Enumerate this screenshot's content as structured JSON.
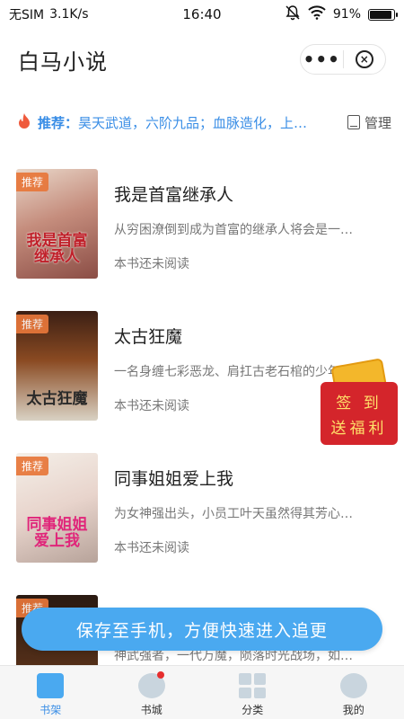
{
  "status_bar": {
    "carrier": "无SIM",
    "speed": "3.1K/s",
    "time": "16:40",
    "battery": "91%",
    "battery_level": 0.91,
    "icons": [
      "mute-bell-icon",
      "wifi-icon",
      "battery-icon"
    ]
  },
  "header": {
    "title": "白马小说",
    "more_icon": "more-dots-icon",
    "close_icon": "close-circle-icon"
  },
  "recommend": {
    "label": "推荐：",
    "text": "昊天武道，六阶九品；血脉造化，上…",
    "manage_label": "管理",
    "icon": "fire-icon"
  },
  "books": [
    {
      "tag": "推荐",
      "cover_title": "我是首富继承人",
      "name": "我是首富继承人",
      "desc": "从穷困潦倒到成为首富的继承人将会是一…",
      "status": "本书还未阅读"
    },
    {
      "tag": "推荐",
      "cover_title": "太古狂魔",
      "name": "太古狂魔",
      "desc": "一名身缠七彩恶龙、肩扛古老石棺的少年…",
      "status": "本书还未阅读"
    },
    {
      "tag": "推荐",
      "cover_title": "同事姐姐爱上我",
      "name": "同事姐姐爱上我",
      "desc": "为女神强出头，小员工叶天虽然得其芳心…",
      "status": "本书还未阅读"
    },
    {
      "tag": "推荐",
      "cover_title": "",
      "name": "",
      "desc": "神武强者，一代万魔，陨落时光战场，如…",
      "status": ""
    }
  ],
  "float_gift": {
    "line1": "签 到",
    "line2": "送福利"
  },
  "save_banner": "保存至手机，方便快速进入追更",
  "tabbar": {
    "items": [
      {
        "label": "书架",
        "icon": "bookshelf-icon",
        "active": true
      },
      {
        "label": "书城",
        "icon": "bookstore-icon",
        "active": false,
        "badge": true
      },
      {
        "label": "分类",
        "icon": "category-icon",
        "active": false
      },
      {
        "label": "我的",
        "icon": "profile-icon",
        "active": false
      }
    ]
  },
  "colors": {
    "accent": "#4aa9f0",
    "link": "#3a8ee6",
    "tag": "#e8773a",
    "gift": "#d4252b"
  }
}
